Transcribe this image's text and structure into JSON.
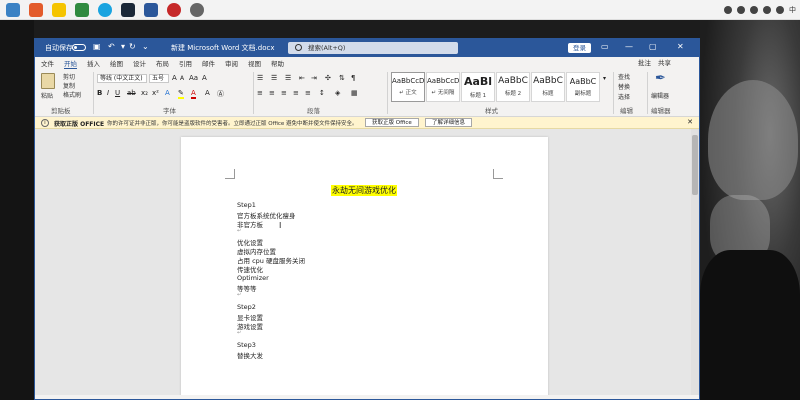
{
  "word": {
    "autosave_label": "自动保存",
    "doc_title": "新建 Microsoft Word 文档.docx",
    "search_placeholder": "搜索(Alt+Q)",
    "login_label": "登录"
  },
  "tabs": [
    "文件",
    "开始",
    "插入",
    "绘图",
    "设计",
    "布局",
    "引用",
    "邮件",
    "审阅",
    "视图",
    "帮助"
  ],
  "tabs_right": {
    "comment": "批注",
    "share": "共享"
  },
  "ribbon": {
    "paste": "粘贴",
    "cut": "剪切",
    "copy": "复制",
    "format_painter": "格式刷",
    "clipboard_group": "剪贴板",
    "font_name": "等线 (中文正文)",
    "font_size": "五号",
    "font_group": "字体",
    "paragraph_group": "段落",
    "styles_group": "样式",
    "editing_group": "编辑",
    "editor_group": "编辑器",
    "find": "查找",
    "replace": "替换",
    "select": "选择",
    "editor_button": "编辑器",
    "styles": [
      {
        "preview": "AaBbCcDd",
        "name": "↵ 正文"
      },
      {
        "preview": "AaBbCcDd",
        "name": "↵ 无间隔"
      },
      {
        "preview": "AaBl",
        "name": "标题 1"
      },
      {
        "preview": "AaBbC",
        "name": "标题 2"
      },
      {
        "preview": "AaBbC",
        "name": "标题"
      },
      {
        "preview": "AaBbC",
        "name": "副标题"
      }
    ]
  },
  "infobar": {
    "title": "获取正版 OFFICE",
    "message": "你的许可证并非正版，你可能是盗版软件的受害者。立即通过正版 Office 避免中断并使文件保持安全。",
    "get_genuine": "获取正版 Office",
    "learn_more": "了解详细信息"
  },
  "document": {
    "title": "永劫无间游戏优化",
    "lines": [
      "Step1",
      "官方板系统优化瘦身",
      "非官方板",
      "",
      "优化设置",
      "虚拟内存位置",
      "占用 cpu 硬盘服务关闭",
      "传速优化",
      "Optimizer",
      "等等等",
      "",
      "Step2",
      "显卡设置",
      "游戏设置",
      "",
      "Step3",
      "替换大发"
    ]
  }
}
